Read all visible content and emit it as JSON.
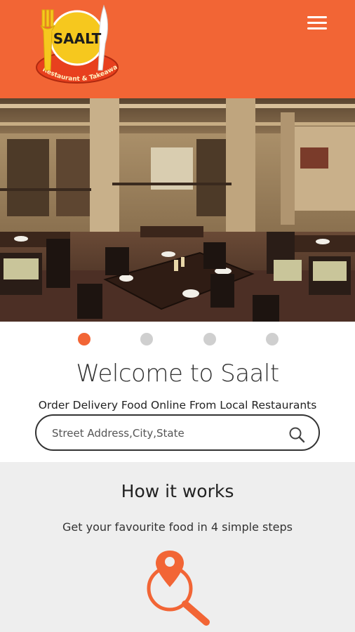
{
  "header": {
    "logo_text": "SAALT",
    "logo_tagline": "Restaurant & Takeaway Food",
    "menu_icon": "hamburger-menu-icon"
  },
  "hero": {
    "image": "restaurant-interior",
    "slides_count": 4,
    "active_slide": 1
  },
  "welcome": {
    "title": "Welcome to Saalt",
    "subtitle": "Order Delivery Food Online From Local Restaurants"
  },
  "search": {
    "placeholder": "Street Address,City,State",
    "icon": "search-icon"
  },
  "how_it_works": {
    "title": "How it works",
    "subtitle": "Get your favourite food in 4 simple steps",
    "step_icon": "location-search-icon"
  },
  "colors": {
    "brand": "#F26535",
    "section_bg": "#EEEEEE",
    "dot_inactive": "#CFCFCF"
  }
}
